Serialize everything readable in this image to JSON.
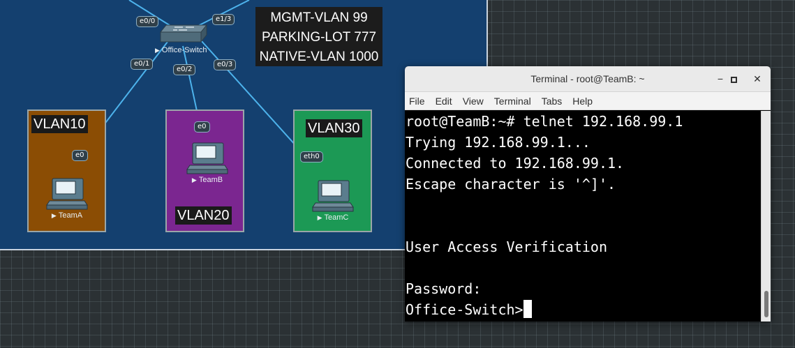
{
  "topology": {
    "info_box": [
      "MGMT-VLAN 99",
      "PARKING-LOT 777",
      "NATIVE-VLAN 1000"
    ],
    "switch": {
      "name": "Office-Switch"
    },
    "switch_ports": [
      "e0/0",
      "e1/3",
      "e0/1",
      "e0/2",
      "e0/3"
    ],
    "vlan_boxes": [
      {
        "label": "VLAN10",
        "color": "#8b4d04"
      },
      {
        "label": "VLAN20",
        "color": "#7b2690"
      },
      {
        "label": "VLAN30",
        "color": "#1c9955"
      }
    ],
    "hosts": [
      {
        "name": "TeamA",
        "port": "e0"
      },
      {
        "name": "TeamB",
        "port": "e0"
      },
      {
        "name": "TeamC",
        "port": "eth0"
      }
    ],
    "link_color": "#4db3ec"
  },
  "terminal": {
    "title": "Terminal - root@TeamB: ~",
    "menu": [
      "File",
      "Edit",
      "View",
      "Terminal",
      "Tabs",
      "Help"
    ],
    "lines": [
      "root@TeamB:~# telnet 192.168.99.1",
      "Trying 192.168.99.1...",
      "Connected to 192.168.99.1.",
      "Escape character is '^]'.",
      "",
      "",
      "User Access Verification",
      "",
      "Password:",
      "Office-Switch>"
    ]
  }
}
